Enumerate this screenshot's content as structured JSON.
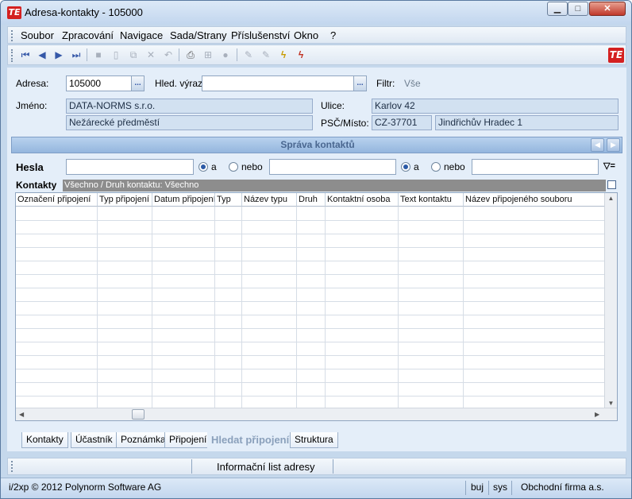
{
  "window": {
    "title": "Adresa-kontakty - 105000",
    "logo_text": "TE",
    "buttons": {
      "minimize": "▁",
      "maximize": "□",
      "close": "✕"
    }
  },
  "menu": [
    "Soubor",
    "Zpracování",
    "Navigace",
    "Sada/Strany",
    "Příslušenství",
    "Okno",
    "?"
  ],
  "toolbar": {
    "icons": [
      "first-icon",
      "prev-icon",
      "next-icon",
      "last-icon",
      "save-icon",
      "new-icon",
      "copy-icon",
      "delete-icon",
      "undo-icon",
      "print-icon",
      "tree-icon",
      "cancel-icon",
      "edit-icon",
      "edit-all-icon",
      "lightning-icon",
      "lightning-cancel-icon"
    ],
    "glyphs": [
      "⏮",
      "◀",
      "▶",
      "⏭",
      "■",
      "▯",
      "⧉",
      "✕",
      "↶",
      "⎙",
      "⊞",
      "●",
      "✎",
      "✎",
      "ϟ",
      "ϟ"
    ]
  },
  "form": {
    "adresa_label": "Adresa:",
    "adresa_value": "105000",
    "hled_label": "Hled. výraz:",
    "hled_value": "",
    "filtr_label": "Filtr:",
    "filtr_value": "Vše",
    "jmeno_label": "Jméno:",
    "jmeno_line1": "DATA-NORMS s.r.o.",
    "jmeno_line2": "Nežárecké předměstí",
    "ulice_label": "Ulice:",
    "ulice_value": "Karlov 42",
    "psc_label": "PSČ/Místo:",
    "psc_value": "CZ-37701",
    "misto_value": "Jindřichův Hradec 1",
    "ellipsis": "..."
  },
  "panel": {
    "title": "Správa kontaktů",
    "nav_left": "◀",
    "nav_right": "▶"
  },
  "search": {
    "hesla_label": "Hesla",
    "a_label": "a",
    "nebo_label": "nebo",
    "filter_icon": "▽="
  },
  "contacts": {
    "label": "Kontakty",
    "filter_text": "Všechno / Druh kontaktu: Všechno",
    "columns": [
      "Označení připojení",
      "Typ připojení",
      "Datum připojení",
      "Typ",
      "Název typu",
      "Druh",
      "Kontaktní osoba",
      "Text kontaktu",
      "Název připojeného souboru"
    ],
    "scroll_up": "▲",
    "scroll_down": "▼",
    "scroll_left": "◀",
    "scroll_right": "▶"
  },
  "tabs": [
    "Kontakty",
    "Účastník",
    "Poznámka",
    "Připojení",
    "Hledat připojení",
    "Struktura"
  ],
  "active_tab": "Hledat připojení",
  "infobar": {
    "text": "Informační list adresy"
  },
  "status": {
    "copyright": "i/2xp © 2012 Polynorm Software AG",
    "user": "buj",
    "system": "sys",
    "company": "Obchodní firma a.s."
  },
  "colors": {
    "accent": "#d42020",
    "panel": "#e4eef9",
    "frame": "#c5d8ec",
    "filter_bar": "#8d8d8d"
  }
}
